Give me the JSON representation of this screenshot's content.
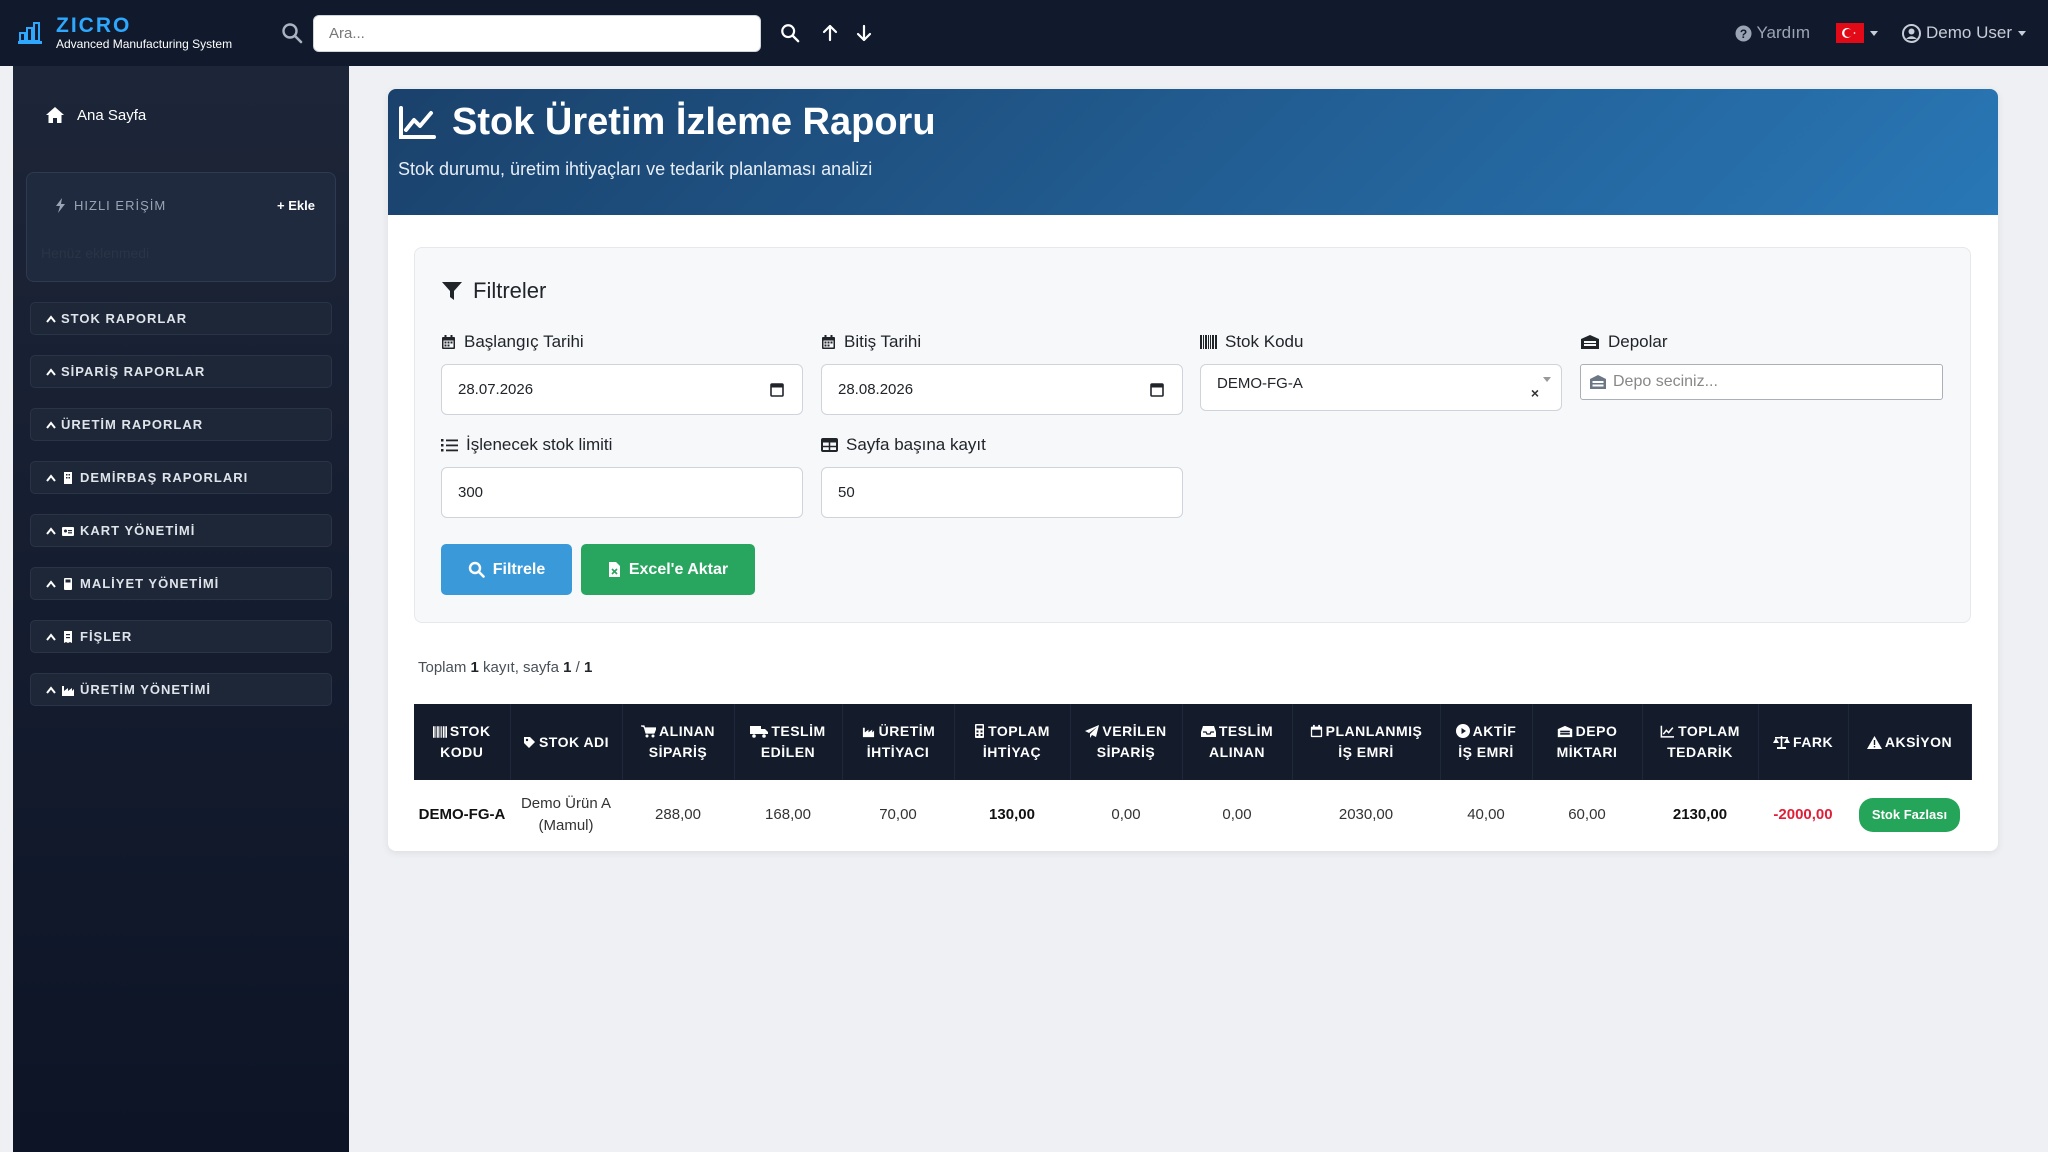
{
  "app": {
    "brand_name": "ZICRO",
    "brand_subtitle": "Advanced Manufacturing System",
    "search_placeholder": "Ara...",
    "help_label": "Yardım",
    "user_label": "Demo User",
    "flag_icon": "turkey-flag-icon"
  },
  "sidebar": {
    "home_label": "Ana Sayfa",
    "quick_access": {
      "title": "HIZLI ERİŞİM",
      "add_label": "Ekle",
      "empty_text": "Henüz eklenmedi"
    },
    "items": [
      {
        "label": "STOK RAPORLAR",
        "icon": "chevron-up-icon"
      },
      {
        "label": "SİPARİŞ RAPORLAR",
        "icon": "chevron-up-icon"
      },
      {
        "label": "ÜRETİM RAPORLAR",
        "icon": "chevron-up-icon"
      },
      {
        "label": "DEMİRBAŞ RAPORLARI",
        "icon": "building-icon"
      },
      {
        "label": "KART YÖNETİMİ",
        "icon": "id-card-icon"
      },
      {
        "label": "MALİYET YÖNETİMİ",
        "icon": "calculator-icon"
      },
      {
        "label": "FİŞLER",
        "icon": "receipt-icon"
      },
      {
        "label": "ÜRETİM YÖNETİMİ",
        "icon": "industry-icon"
      }
    ]
  },
  "report": {
    "title": "Stok Üretim İzleme Raporu",
    "subtitle": "Stok durumu, üretim ihtiyaçları ve tedarik planlaması analizi"
  },
  "filters": {
    "title": "Filtreler",
    "start_date": {
      "label": "Başlangıç Tarihi",
      "value": "28.07.2026"
    },
    "end_date": {
      "label": "Bitiş Tarihi",
      "value": "28.08.2026"
    },
    "stock_code": {
      "label": "Stok Kodu",
      "value": "DEMO-FG-A"
    },
    "warehouses": {
      "label": "Depolar",
      "placeholder": "Depo seciniz..."
    },
    "stock_limit": {
      "label": "İşlenecek stok limiti",
      "value": "300"
    },
    "page_size": {
      "label": "Sayfa başına kayıt",
      "value": "50"
    },
    "filter_button": "Filtrele",
    "export_button": "Excel'e Aktar"
  },
  "summary": {
    "prefix": "Toplam",
    "total": "1",
    "middle": "kayıt, sayfa",
    "page": "1",
    "sep": "/",
    "pages": "1"
  },
  "table": {
    "headers": [
      {
        "l1": "STOK",
        "l2": "KODU",
        "icon": "barcode-icon"
      },
      {
        "l1": "STOK ADI",
        "l2": "",
        "icon": "tag-icon"
      },
      {
        "l1": "ALINAN",
        "l2": "SİPARİŞ",
        "icon": "cart-icon"
      },
      {
        "l1": "TESLİM",
        "l2": "EDİLEN",
        "icon": "truck-icon"
      },
      {
        "l1": "ÜRETİM",
        "l2": "İHTİYACI",
        "icon": "industry-icon"
      },
      {
        "l1": "TOPLAM",
        "l2": "İHTİYAÇ",
        "icon": "calculator-icon"
      },
      {
        "l1": "VERİLEN",
        "l2": "SİPARİŞ",
        "icon": "send-icon"
      },
      {
        "l1": "TESLİM",
        "l2": "ALINAN",
        "icon": "inbox-icon"
      },
      {
        "l1": "PLANLANMIŞ",
        "l2": "İŞ EMRİ",
        "icon": "calendar-icon"
      },
      {
        "l1": "AKTİF",
        "l2": "İŞ EMRİ",
        "icon": "play-icon"
      },
      {
        "l1": "DEPO",
        "l2": "MİKTARI",
        "icon": "warehouse-icon"
      },
      {
        "l1": "TOPLAM",
        "l2": "TEDARİK",
        "icon": "chart-line-icon"
      },
      {
        "l1": "FARK",
        "l2": "",
        "icon": "balance-icon"
      },
      {
        "l1": "AKSİYON",
        "l2": "",
        "icon": "warning-icon"
      }
    ],
    "rows": [
      {
        "stock_code": "DEMO-FG-A",
        "stock_name": "Demo Ürün A (Mamul)",
        "received_orders": "288,00",
        "delivered": "168,00",
        "production_need": "70,00",
        "total_need": "130,00",
        "placed_orders": "0,00",
        "received": "0,00",
        "planned_work_orders": "2030,00",
        "active_work_orders": "40,00",
        "warehouse_qty": "60,00",
        "total_supply": "2130,00",
        "difference": "-2000,00",
        "action": "Stok Fazlası"
      }
    ]
  },
  "colors": {
    "topbar": "#111a2c",
    "brand_accent": "#2ea8ff",
    "header_gradient_start": "#1a416b",
    "header_gradient_end": "#2977b6",
    "filter_button": "#3a9ad9",
    "export_button": "#28a55f",
    "negative": "#e01e37",
    "badge": "#25a559"
  }
}
